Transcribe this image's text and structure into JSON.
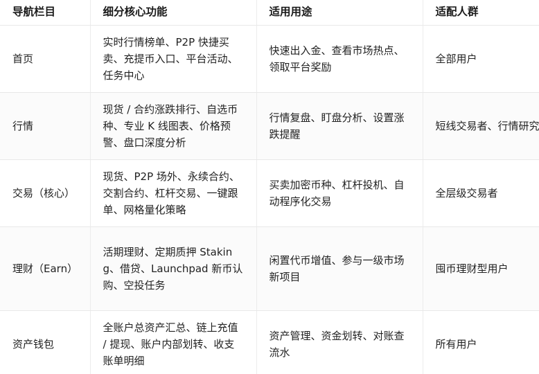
{
  "table": {
    "headers": [
      "导航栏目",
      "细分核心功能",
      "适用用途",
      "适配人群"
    ],
    "rows": [
      {
        "nav": "首页",
        "features": "实时行情榜单、P2P 快捷买卖、充提币入口、平台活动、任务中心",
        "usage": "快速出入金、查看市场热点、领取平台奖励",
        "audience": "全部用户"
      },
      {
        "nav": "行情",
        "features": "现货 / 合约涨跌排行、自选币种、专业 K 线图表、价格预警、盘口深度分析",
        "usage": "行情复盘、盯盘分析、设置涨跌提醒",
        "audience": "短线交易者、行情研究"
      },
      {
        "nav": "交易（核心）",
        "features": "现货、P2P 场外、永续合约、交割合约、杠杆交易、一键跟单、网格量化策略",
        "usage": "买卖加密币种、杠杆投机、自动程序化交易",
        "audience": "全层级交易者"
      },
      {
        "nav": "理财（Earn）",
        "features": "活期理财、定期质押 Staking、借贷、Launchpad 新币认购、空投任务",
        "usage": "闲置代币增值、参与一级市场新项目",
        "audience": "囤币理财型用户"
      },
      {
        "nav": "资产钱包",
        "features": "全账户总资产汇总、链上充值 / 提现、账户内部划转、收支账单明细",
        "usage": "资产管理、资金划转、对账查流水",
        "audience": "所有用户"
      }
    ]
  }
}
